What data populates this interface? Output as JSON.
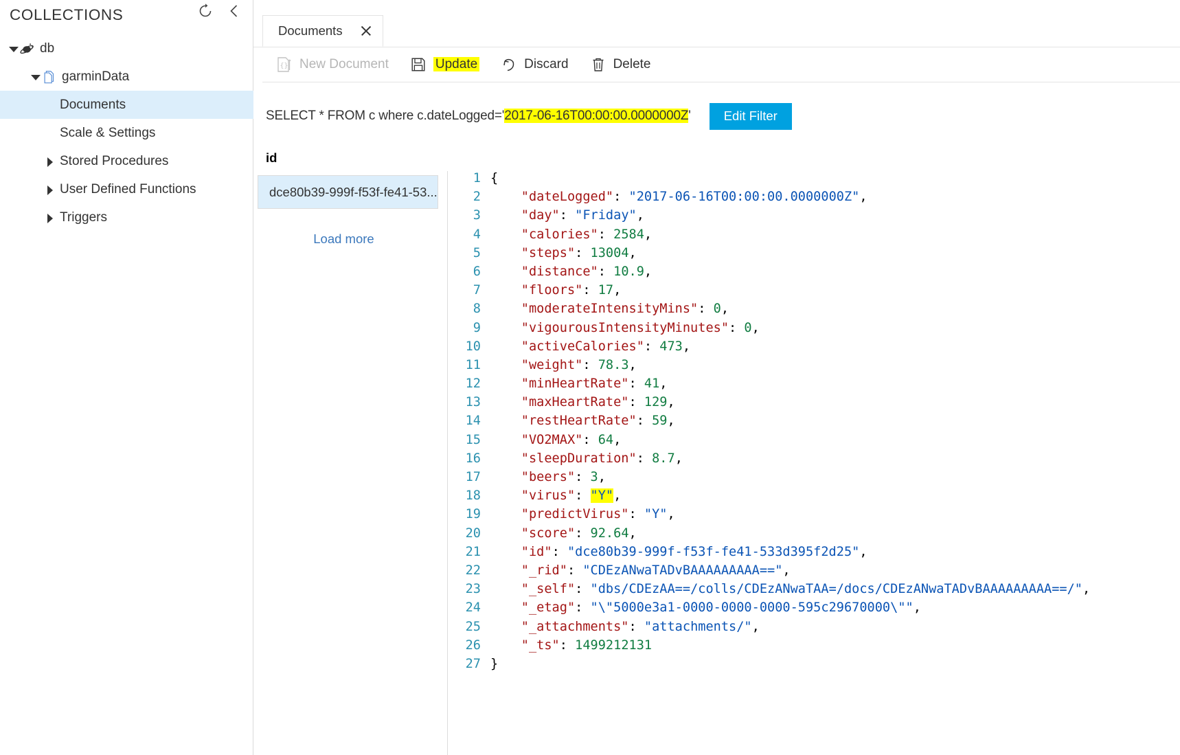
{
  "sidebar": {
    "title": "COLLECTIONS",
    "refresh_icon": "refresh-icon",
    "collapse_icon": "chevron-left-icon",
    "tree": [
      {
        "label": "db",
        "icon": "database-account-icon",
        "caret": "down",
        "level": 0,
        "selected": false
      },
      {
        "label": "garminData",
        "icon": "collection-icon",
        "caret": "down",
        "level": 1,
        "selected": false
      },
      {
        "label": "Documents",
        "icon": "",
        "caret": "none",
        "level": 2,
        "selected": true
      },
      {
        "label": "Scale & Settings",
        "icon": "",
        "caret": "none",
        "level": 2,
        "selected": false
      },
      {
        "label": "Stored Procedures",
        "icon": "",
        "caret": "right",
        "level": 3,
        "selected": false
      },
      {
        "label": "User Defined Functions",
        "icon": "",
        "caret": "right",
        "level": 3,
        "selected": false
      },
      {
        "label": "Triggers",
        "icon": "",
        "caret": "right",
        "level": 3,
        "selected": false
      }
    ]
  },
  "tab": {
    "label": "Documents",
    "close_icon": "close-icon"
  },
  "toolbar": {
    "new_document_label": "New Document",
    "new_document_icon": "new-document-icon",
    "new_document_disabled": true,
    "update_label": "Update",
    "update_icon": "save-icon",
    "update_highlighted": true,
    "discard_label": "Discard",
    "discard_icon": "undo-icon",
    "delete_label": "Delete",
    "delete_icon": "trash-icon"
  },
  "query": {
    "prefix": "SELECT * FROM c where c.dateLogged='",
    "highlighted_value": "2017-06-16T00:00:00.0000000Z",
    "suffix": "'",
    "edit_filter_label": "Edit Filter",
    "edit_filter_color": "#00a1e0",
    "highlight_color": "#ffff00"
  },
  "results": {
    "column_header": "id",
    "items": [
      {
        "label": "dce80b39-999f-f53f-fe41-53...",
        "selected": true
      }
    ],
    "load_more_label": "Load more"
  },
  "editor": {
    "total_lines": 27,
    "lines": [
      {
        "n": 1,
        "indent": 0,
        "tokens": [
          {
            "t": "{",
            "c": "p"
          }
        ]
      },
      {
        "n": 2,
        "indent": 1,
        "tokens": [
          {
            "t": "\"dateLogged\"",
            "c": "k"
          },
          {
            "t": ": ",
            "c": "p"
          },
          {
            "t": "\"2017-06-16T00:00:00.0000000Z\"",
            "c": "s"
          },
          {
            "t": ",",
            "c": "p"
          }
        ]
      },
      {
        "n": 3,
        "indent": 1,
        "tokens": [
          {
            "t": "\"day\"",
            "c": "k"
          },
          {
            "t": ": ",
            "c": "p"
          },
          {
            "t": "\"Friday\"",
            "c": "s"
          },
          {
            "t": ",",
            "c": "p"
          }
        ]
      },
      {
        "n": 4,
        "indent": 1,
        "tokens": [
          {
            "t": "\"calories\"",
            "c": "k"
          },
          {
            "t": ": ",
            "c": "p"
          },
          {
            "t": "2584",
            "c": "n"
          },
          {
            "t": ",",
            "c": "p"
          }
        ]
      },
      {
        "n": 5,
        "indent": 1,
        "tokens": [
          {
            "t": "\"steps\"",
            "c": "k"
          },
          {
            "t": ": ",
            "c": "p"
          },
          {
            "t": "13004",
            "c": "n"
          },
          {
            "t": ",",
            "c": "p"
          }
        ]
      },
      {
        "n": 6,
        "indent": 1,
        "tokens": [
          {
            "t": "\"distance\"",
            "c": "k"
          },
          {
            "t": ": ",
            "c": "p"
          },
          {
            "t": "10.9",
            "c": "n"
          },
          {
            "t": ",",
            "c": "p"
          }
        ]
      },
      {
        "n": 7,
        "indent": 1,
        "tokens": [
          {
            "t": "\"floors\"",
            "c": "k"
          },
          {
            "t": ": ",
            "c": "p"
          },
          {
            "t": "17",
            "c": "n"
          },
          {
            "t": ",",
            "c": "p"
          }
        ]
      },
      {
        "n": 8,
        "indent": 1,
        "tokens": [
          {
            "t": "\"moderateIntensityMins\"",
            "c": "k"
          },
          {
            "t": ": ",
            "c": "p"
          },
          {
            "t": "0",
            "c": "n"
          },
          {
            "t": ",",
            "c": "p"
          }
        ]
      },
      {
        "n": 9,
        "indent": 1,
        "tokens": [
          {
            "t": "\"vigourousIntensityMinutes\"",
            "c": "k"
          },
          {
            "t": ": ",
            "c": "p"
          },
          {
            "t": "0",
            "c": "n"
          },
          {
            "t": ",",
            "c": "p"
          }
        ]
      },
      {
        "n": 10,
        "indent": 1,
        "tokens": [
          {
            "t": "\"activeCalories\"",
            "c": "k"
          },
          {
            "t": ": ",
            "c": "p"
          },
          {
            "t": "473",
            "c": "n"
          },
          {
            "t": ",",
            "c": "p"
          }
        ]
      },
      {
        "n": 11,
        "indent": 1,
        "tokens": [
          {
            "t": "\"weight\"",
            "c": "k"
          },
          {
            "t": ": ",
            "c": "p"
          },
          {
            "t": "78.3",
            "c": "n"
          },
          {
            "t": ",",
            "c": "p"
          }
        ]
      },
      {
        "n": 12,
        "indent": 1,
        "tokens": [
          {
            "t": "\"minHeartRate\"",
            "c": "k"
          },
          {
            "t": ": ",
            "c": "p"
          },
          {
            "t": "41",
            "c": "n"
          },
          {
            "t": ",",
            "c": "p"
          }
        ]
      },
      {
        "n": 13,
        "indent": 1,
        "tokens": [
          {
            "t": "\"maxHeartRate\"",
            "c": "k"
          },
          {
            "t": ": ",
            "c": "p"
          },
          {
            "t": "129",
            "c": "n"
          },
          {
            "t": ",",
            "c": "p"
          }
        ]
      },
      {
        "n": 14,
        "indent": 1,
        "tokens": [
          {
            "t": "\"restHeartRate\"",
            "c": "k"
          },
          {
            "t": ": ",
            "c": "p"
          },
          {
            "t": "59",
            "c": "n"
          },
          {
            "t": ",",
            "c": "p"
          }
        ]
      },
      {
        "n": 15,
        "indent": 1,
        "tokens": [
          {
            "t": "\"VO2MAX\"",
            "c": "k"
          },
          {
            "t": ": ",
            "c": "p"
          },
          {
            "t": "64",
            "c": "n"
          },
          {
            "t": ",",
            "c": "p"
          }
        ]
      },
      {
        "n": 16,
        "indent": 1,
        "tokens": [
          {
            "t": "\"sleepDuration\"",
            "c": "k"
          },
          {
            "t": ": ",
            "c": "p"
          },
          {
            "t": "8.7",
            "c": "n"
          },
          {
            "t": ",",
            "c": "p"
          }
        ]
      },
      {
        "n": 17,
        "indent": 1,
        "tokens": [
          {
            "t": "\"beers\"",
            "c": "k"
          },
          {
            "t": ": ",
            "c": "p"
          },
          {
            "t": "3",
            "c": "n"
          },
          {
            "t": ",",
            "c": "p"
          }
        ]
      },
      {
        "n": 18,
        "indent": 1,
        "tokens": [
          {
            "t": "\"virus\"",
            "c": "k"
          },
          {
            "t": ": ",
            "c": "p"
          },
          {
            "t": "\"Y\"",
            "c": "s",
            "mark": true
          },
          {
            "t": ",",
            "c": "p"
          }
        ]
      },
      {
        "n": 19,
        "indent": 1,
        "tokens": [
          {
            "t": "\"predictVirus\"",
            "c": "k"
          },
          {
            "t": ": ",
            "c": "p"
          },
          {
            "t": "\"Y\"",
            "c": "s"
          },
          {
            "t": ",",
            "c": "p"
          }
        ]
      },
      {
        "n": 20,
        "indent": 1,
        "tokens": [
          {
            "t": "\"score\"",
            "c": "k"
          },
          {
            "t": ": ",
            "c": "p"
          },
          {
            "t": "92.64",
            "c": "n"
          },
          {
            "t": ",",
            "c": "p"
          }
        ]
      },
      {
        "n": 21,
        "indent": 1,
        "tokens": [
          {
            "t": "\"id\"",
            "c": "k"
          },
          {
            "t": ": ",
            "c": "p"
          },
          {
            "t": "\"dce80b39-999f-f53f-fe41-533d395f2d25\"",
            "c": "s"
          },
          {
            "t": ",",
            "c": "p"
          }
        ]
      },
      {
        "n": 22,
        "indent": 1,
        "tokens": [
          {
            "t": "\"_rid\"",
            "c": "k"
          },
          {
            "t": ": ",
            "c": "p"
          },
          {
            "t": "\"CDEzANwaTADvBAAAAAAAAA==\"",
            "c": "s"
          },
          {
            "t": ",",
            "c": "p"
          }
        ]
      },
      {
        "n": 23,
        "indent": 1,
        "tokens": [
          {
            "t": "\"_self\"",
            "c": "k"
          },
          {
            "t": ": ",
            "c": "p"
          },
          {
            "t": "\"dbs/CDEzAA==/colls/CDEzANwaTAA=/docs/CDEzANwaTADvBAAAAAAAAA==/\"",
            "c": "s"
          },
          {
            "t": ",",
            "c": "p"
          }
        ]
      },
      {
        "n": 24,
        "indent": 1,
        "tokens": [
          {
            "t": "\"_etag\"",
            "c": "k"
          },
          {
            "t": ": ",
            "c": "p"
          },
          {
            "t": "\"\\\"5000e3a1-0000-0000-0000-595c29670000\\\"\"",
            "c": "s"
          },
          {
            "t": ",",
            "c": "p"
          }
        ]
      },
      {
        "n": 25,
        "indent": 1,
        "tokens": [
          {
            "t": "\"_attachments\"",
            "c": "k"
          },
          {
            "t": ": ",
            "c": "p"
          },
          {
            "t": "\"attachments/\"",
            "c": "s"
          },
          {
            "t": ",",
            "c": "p"
          }
        ]
      },
      {
        "n": 26,
        "indent": 1,
        "tokens": [
          {
            "t": "\"_ts\"",
            "c": "k"
          },
          {
            "t": ": ",
            "c": "p"
          },
          {
            "t": "1499212131",
            "c": "n"
          }
        ]
      },
      {
        "n": 27,
        "indent": 0,
        "tokens": [
          {
            "t": "}",
            "c": "p"
          }
        ]
      }
    ]
  }
}
